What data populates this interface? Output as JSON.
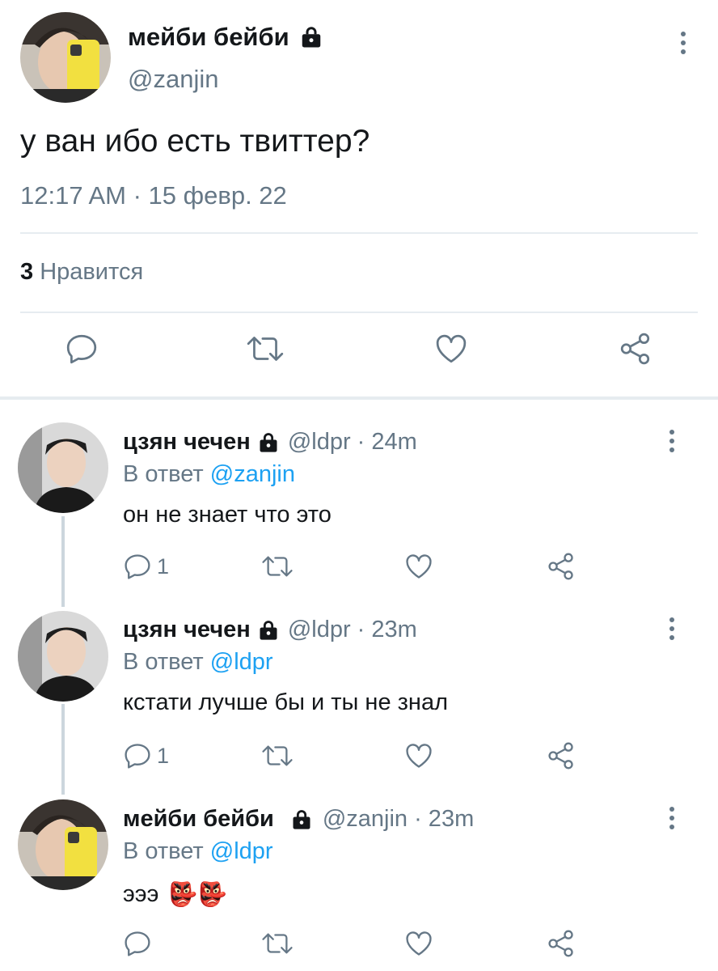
{
  "main_tweet": {
    "display_name": "мейби бейби",
    "handle": "@zanjin",
    "text": "у ван ибо есть твиттер?",
    "timestamp": "12:17 AM · 15 февр. 22",
    "likes_count": "3",
    "likes_label": "Нравится"
  },
  "replies": [
    {
      "display_name": "цзян чечен",
      "handle_time": "@ldpr · 24m",
      "reply_prefix": "В ответ",
      "reply_to": "@zanjin",
      "text": "он не знает что это",
      "reply_count": "1"
    },
    {
      "display_name": "цзян чечен",
      "handle_time": "@ldpr · 23m",
      "reply_prefix": "В ответ",
      "reply_to": "@ldpr",
      "text": "кстати лучше бы и ты не знал",
      "reply_count": "1"
    },
    {
      "display_name": "мейби бейби",
      "handle_time": "@zanjin · 23m",
      "reply_prefix": "В ответ",
      "reply_to": "@ldpr",
      "text": "эээ",
      "emoji": "👺👺",
      "reply_count": ""
    }
  ],
  "colors": {
    "text": "#14171a",
    "secondary": "#657786",
    "accent": "#1da1f2",
    "divider": "#e6ecf0",
    "thread_line": "#ccd6dd"
  },
  "icons": [
    "lock-icon",
    "more-vertical-icon",
    "reply-icon",
    "retweet-icon",
    "like-icon",
    "share-icon"
  ]
}
